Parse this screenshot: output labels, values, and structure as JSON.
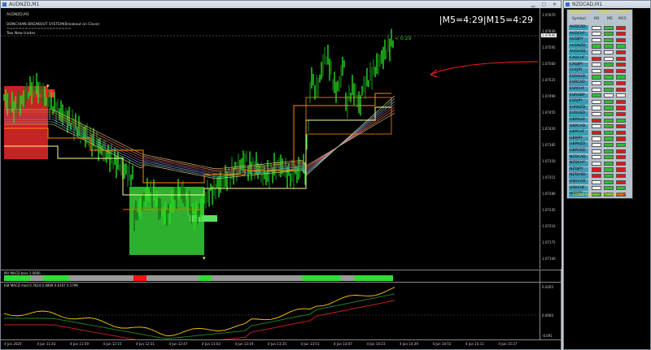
{
  "main": {
    "window_title": "AUDNZD,M1",
    "chart_title": "AUDNZD,M1",
    "indicator_name": "DONCHIAN BREAKOUT SYSTEM(Breakout on Close)",
    "indicator_sep": "=====================",
    "trades_label": "Two New trades",
    "tf_readout": "|M5=4:29|M15=4:29",
    "price_tag": "< 0:29",
    "price_axis": [
      "1.07670",
      "1.07630",
      "1.07595",
      "1.07560",
      "1.07525",
      "1.07490",
      "1.07455",
      "1.07420",
      "1.07385",
      "1.07350",
      "1.07315",
      "1.07280",
      "1.07245",
      "1.07210",
      "1.07175",
      "1.07140"
    ],
    "current_price": "1.07646",
    "sub1_label": "MV MACD bars 1.0666",
    "sub2_label": "ISB MACD mod 0.7624 0.4869 0.6167 0.1796",
    "sub2_axis_top": "0.0265",
    "sub2_axis_mid": "0.0000",
    "sub2_axis_bot": "-0.091",
    "time_axis": [
      "4 Jun 2020",
      "4 Jun 11:43",
      "4 Jun 11:59",
      "4 Jun 12:15",
      "4 Jun 12:31",
      "4 Jun 12:47",
      "4 Jun 13:03",
      "4 Jun 13:19",
      "4 Jun 13:35",
      "4 Jun 13:51",
      "4 Jun 14:07",
      "4 Jun 14:23",
      "4 Jun 14:39",
      "4 Jun 14:55",
      "4 Jun 15:11",
      "4 Jun 15:27"
    ],
    "bar_strip": [
      "green",
      "green",
      "gray",
      "green",
      "green",
      "gray",
      "gray",
      "gray",
      "gray",
      "gray",
      "red",
      "gray",
      "gray",
      "gray",
      "gray",
      "green",
      "gray",
      "gray",
      "gray",
      "gray",
      "gray",
      "gray",
      "gray",
      "green",
      "green",
      "green",
      "gray",
      "green",
      "green",
      "green"
    ],
    "colors": {
      "bull": "#22cc22",
      "bear": "#1a7a1a",
      "orange": "#ff8c00",
      "yellow": "#ffff80",
      "red_box": "#cc2222",
      "green_box": "#2db02d"
    }
  },
  "scanner": {
    "window_title": "NZDCAD,M1",
    "header_left": "NZDCAD,M1",
    "header_right": "T3TRIX_SCANNER",
    "col_symbol": "Symbol",
    "col_m1": "M1",
    "col_m5": "M5",
    "col_m15": "M15",
    "footer": "T3TRIX Scanner - STANDOFFAB™",
    "rows": [
      {
        "symbol": "AUDCAD",
        "m1": "white",
        "m5": "green",
        "m15": "red"
      },
      {
        "symbol": "AUDCHF",
        "m1": "white",
        "m5": "green",
        "m15": "red"
      },
      {
        "symbol": "AUDJPY",
        "m1": "white",
        "m5": "green",
        "m15": "red"
      },
      {
        "symbol": "AUDNZD",
        "m1": "green",
        "m5": "green",
        "m15": "green"
      },
      {
        "symbol": "AUDUSD",
        "m1": "white",
        "m5": "white",
        "m15": "red"
      },
      {
        "symbol": "CADCHF",
        "m1": "red",
        "m5": "white",
        "m15": "red"
      },
      {
        "symbol": "CADJPY",
        "m1": "white",
        "m5": "green",
        "m15": "red"
      },
      {
        "symbol": "CHFJPY",
        "m1": "white",
        "m5": "red",
        "m15": "red"
      },
      {
        "symbol": "EURAUD",
        "m1": "green",
        "m5": "green",
        "m15": "green"
      },
      {
        "symbol": "EURCAD",
        "m1": "white",
        "m5": "green",
        "m15": "red"
      },
      {
        "symbol": "EURCHF",
        "m1": "white",
        "m5": "green",
        "m15": "red"
      },
      {
        "symbol": "EURGBP",
        "m1": "green",
        "m5": "white",
        "m15": "white"
      },
      {
        "symbol": "EURJPY",
        "m1": "white",
        "m5": "green",
        "m15": "red"
      },
      {
        "symbol": "EURNZD",
        "m1": "white",
        "m5": "green",
        "m15": "red"
      },
      {
        "symbol": "EURUSD",
        "m1": "white",
        "m5": "green",
        "m15": "red"
      },
      {
        "symbol": "GBPAUD",
        "m1": "red",
        "m5": "green",
        "m15": "green"
      },
      {
        "symbol": "GBPCAD",
        "m1": "white",
        "m5": "green",
        "m15": "red"
      },
      {
        "symbol": "GBPCHF",
        "m1": "red",
        "m5": "green",
        "m15": "red"
      },
      {
        "symbol": "GBPJPY",
        "m1": "white",
        "m5": "green",
        "m15": "red"
      },
      {
        "symbol": "GBPNZD",
        "m1": "white",
        "m5": "green",
        "m15": "green"
      },
      {
        "symbol": "GBPUSD",
        "m1": "white",
        "m5": "green",
        "m15": "red"
      },
      {
        "symbol": "NZDCAD",
        "m1": "white",
        "m5": "green",
        "m15": "red"
      },
      {
        "symbol": "NZDCHF",
        "m1": "white",
        "m5": "green",
        "m15": "red"
      },
      {
        "symbol": "NZDJPY",
        "m1": "red",
        "m5": "green",
        "m15": "red"
      },
      {
        "symbol": "NZDUSD",
        "m1": "red",
        "m5": "green",
        "m15": "red"
      },
      {
        "symbol": "USDCAD",
        "m1": "white",
        "m5": "green",
        "m15": "red"
      },
      {
        "symbol": "USDCHF",
        "m1": "white",
        "m5": "green",
        "m15": "green"
      },
      {
        "symbol": "USDJPY",
        "m1": "green",
        "m5": "green",
        "m15": "red"
      }
    ]
  }
}
